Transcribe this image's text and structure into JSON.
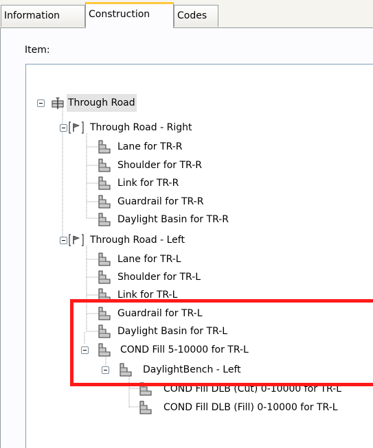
{
  "tabs": [
    {
      "label": "Information"
    },
    {
      "label": "Construction"
    },
    {
      "label": "Codes"
    }
  ],
  "item_label": "Item:",
  "tree": {
    "root": "Through Road",
    "right": {
      "label": "Through Road - Right",
      "children": [
        "Lane for TR-R",
        "Shoulder for TR-R",
        "Link for TR-R",
        "Guardrail for TR-R",
        "Daylight Basin for TR-R"
      ]
    },
    "left": {
      "label": "Through Road - Left",
      "children": [
        "Lane for TR-L",
        "Shoulder for TR-L",
        "Link for TR-L",
        "Guardrail for TR-L",
        "Daylight Basin for TR-L"
      ]
    },
    "cond": {
      "label": "COND Fill 5-10000 for TR-L",
      "bench": {
        "label": "DaylightBench - Left",
        "children": [
          "COND Fill DLB (Cut) 0-10000 for TR-L",
          "COND Fill DLB (Fill) 0-10000 for TR-L"
        ]
      }
    }
  },
  "colors": {
    "highlight_border": "#ff1a1a",
    "active_tab_accent": "#ffc83c"
  }
}
